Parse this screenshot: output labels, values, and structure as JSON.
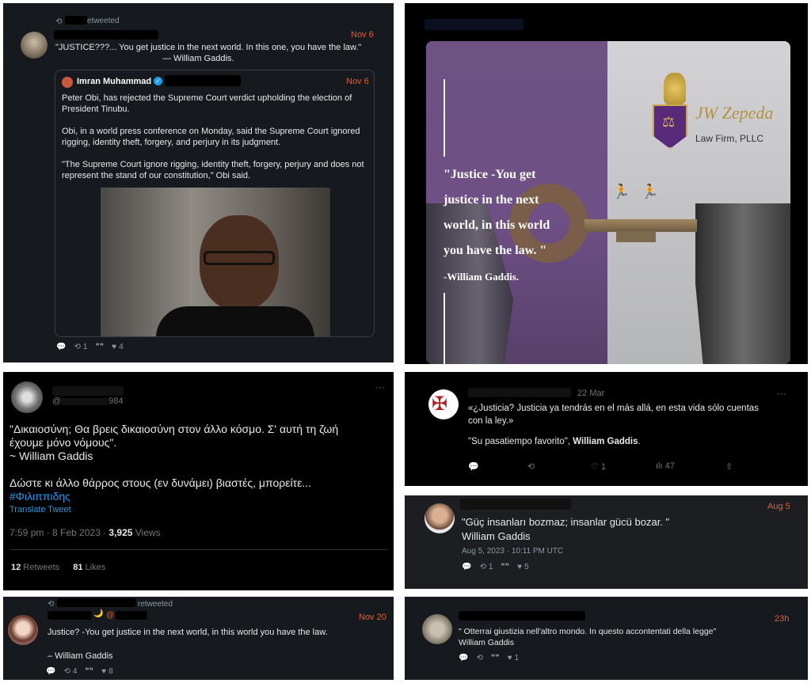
{
  "p1": {
    "retweet_label": "etweeted",
    "date": "Nov 6",
    "quote": "\"JUSTICE???... You get justice in the next world. In this one, you have the law.\"",
    "quote_author": "— William Gaddis.",
    "inner": {
      "name": "Imran Muhammad",
      "date": "Nov 6",
      "para1": "Peter Obi, has rejected the Supreme Court verdict upholding the election of President Tinubu.",
      "para2": "Obi, in a world press conference on Monday, said the Supreme Court ignored rigging, identity theft, forgery, and perjury in its judgment.",
      "para3": "\"The Supreme Court ignore rigging, identity theft, forgery, perjury and does not represent the stand of our constitution,\" Obi said."
    },
    "actions": {
      "retweets": "1",
      "likes": "4"
    }
  },
  "p2": {
    "quote_l1": "\"Justice -You get",
    "quote_l2": "justice in the next",
    "quote_l3": "world, in this world",
    "quote_l4": "you have the law. \"",
    "author": "-William Gaddis.",
    "firm_script": "JW Zepeda",
    "firm_name": "Law Firm, PLLC"
  },
  "p3": {
    "handle": "@",
    "handle_tail": "984",
    "line1": "\"Δικαιοσύνη; Θα βρεις δικαιοσύνη στον άλλο κόσμο. Σ' αυτή τη ζωή",
    "line2": "έχουμε μόνο νόμους\".",
    "line3": "~ William Gaddis",
    "line4": "Δώστε κι άλλο θάρρος στους (εν δυνάμει) βιαστές, μπορείτε...",
    "hashtag": "#Φιλιππιδης",
    "translate": "Translate Tweet",
    "timestamp": "7:59 pm · 8 Feb 2023 · ",
    "views_count": "3,925",
    "views_label": " Views",
    "retweets_count": "12",
    "retweets_label": " Retweets",
    "likes_count": "81",
    "likes_label": " Likes"
  },
  "p4": {
    "date": "22 Mar",
    "line1": "«¿Justicia? Justicia ya tendrás en el más allá, en esta vida sólo cuentas",
    "line2": "con la ley.»",
    "line3_pre": "\"Su pasatiempo favorito\", ",
    "line3_bold": "William Gaddis",
    "line3_post": ".",
    "likes": "1",
    "views": "47"
  },
  "p5": {
    "date": "Aug 5",
    "line1": "\"Güç insanları bozmaz; insanlar gücü bozar. \"",
    "line2": "William Gaddis",
    "timestamp": "Aug 5, 2023 · 10:11 PM UTC",
    "retweets": "1",
    "likes": "5"
  },
  "p6": {
    "retweet_label": "retweeted",
    "handle": "@",
    "date": "Nov 20",
    "line1": "Justice? -You get justice in the next world, in this world you have the law.",
    "line2": "– William Gaddis",
    "retweets": "4",
    "likes": "8"
  },
  "p7": {
    "date": "23h",
    "line1": "\" Otterrai giustizia nell'altro mondo. In questo accontentati della legge\"",
    "line2": "William Gaddis",
    "likes": "1"
  },
  "colors": {
    "accent_orange": "#e0602e",
    "link_blue": "#1d9bf0",
    "purple": "#6b4a86"
  }
}
